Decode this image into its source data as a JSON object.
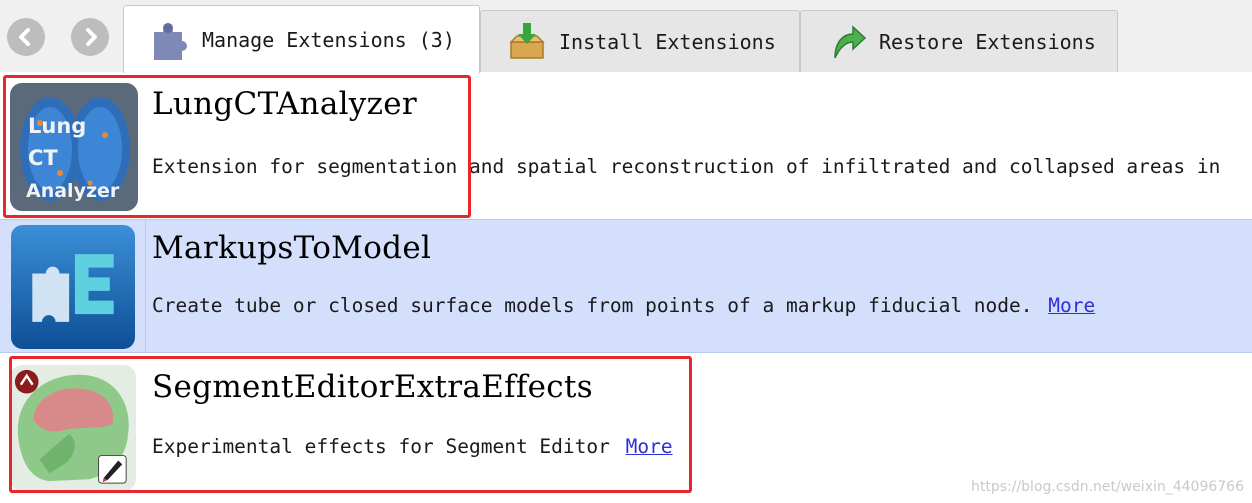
{
  "toolbar": {
    "back_icon": "back-arrow-icon",
    "forward_icon": "forward-arrow-icon"
  },
  "tabs": [
    {
      "label": "Manage Extensions (3)",
      "icon": "puzzle-icon",
      "active": true
    },
    {
      "label": "Install Extensions",
      "icon": "install-box-icon",
      "active": false
    },
    {
      "label": "Restore Extensions",
      "icon": "restore-arrow-icon",
      "active": false
    }
  ],
  "extensions": [
    {
      "name": "LungCTAnalyzer",
      "description": "Extension for segmentation and spatial reconstruction of infiltrated and collapsed areas in",
      "thumb_text": [
        "Lung",
        "CT",
        "Analyzer"
      ],
      "selected": false
    },
    {
      "name": "MarkupsToModel",
      "description": "Create tube or closed surface models from points of a markup fiducial node.",
      "more": "More",
      "selected": true
    },
    {
      "name": "SegmentEditorExtraEffects",
      "description": "Experimental effects for Segment Editor",
      "more": "More",
      "selected": false
    }
  ],
  "watermark": "https://blog.csdn.net/weixin_44096766",
  "colors": {
    "highlight": "#e8262b",
    "selected_row": "#d3dffb",
    "link": "#2f2fd6"
  }
}
